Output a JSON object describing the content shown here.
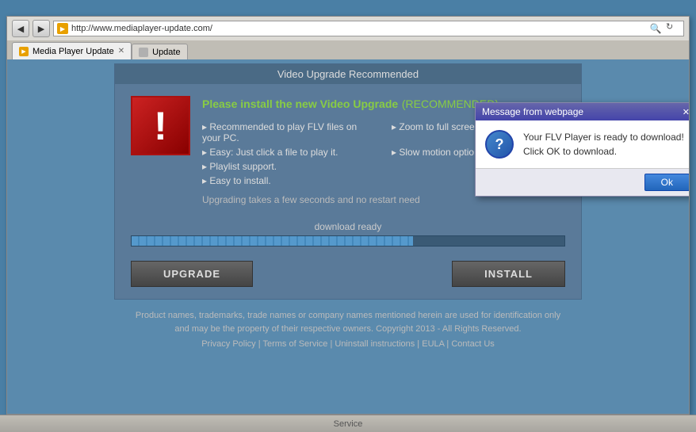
{
  "browser": {
    "back_label": "◀",
    "forward_label": "▶",
    "address_text": "http://www.mediaplayer-update.com/",
    "search_icon": "🔍",
    "refresh_icon": "↻",
    "tab1_label": "Media Player Update",
    "tab2_label": "Update",
    "tab1_favicon": "▶",
    "tab2_favicon": ""
  },
  "page": {
    "card_title": "Video Upgrade Recommended",
    "headline_main": "Please install the new Video Upgrade",
    "headline_recommended": "(RECOMMENDED)",
    "feature1": "Recommended to play FLV files on your PC.",
    "feature2": "Zoom to full screen.",
    "feature3": "Easy: Just click a file to play it.",
    "feature4": "Slow motion option.",
    "feature5": "Playlist support.",
    "feature6": "",
    "feature7": "Easy to install.",
    "feature8": "",
    "upgrade_note": "Upgrading takes a few seconds and no restart need",
    "progress_label": "download ready",
    "upgrade_btn": "UPGRADE",
    "install_btn": "INSTALL",
    "footer_text": "Product names, trademarks, trade names or company names mentioned herein are used for identification only\nand may be the property of their respective owners. Copyright 2013 - All Rights Reserved.",
    "footer_link1": "Privacy Policy",
    "footer_sep1": " | ",
    "footer_link2": "Terms of Service",
    "footer_sep2": " | ",
    "footer_link3": "Uninstall instructions",
    "footer_sep3": " | ",
    "footer_link4": "EULA",
    "footer_sep4": " | ",
    "footer_link5": "Contact Us"
  },
  "dialog": {
    "title": "Message from webpage",
    "icon_label": "?",
    "message_line1": "Your FLV Player is ready to download!",
    "message_line2": "Click OK to download.",
    "ok_label": "Ok"
  },
  "taskbar": {
    "service_label": "Service"
  }
}
